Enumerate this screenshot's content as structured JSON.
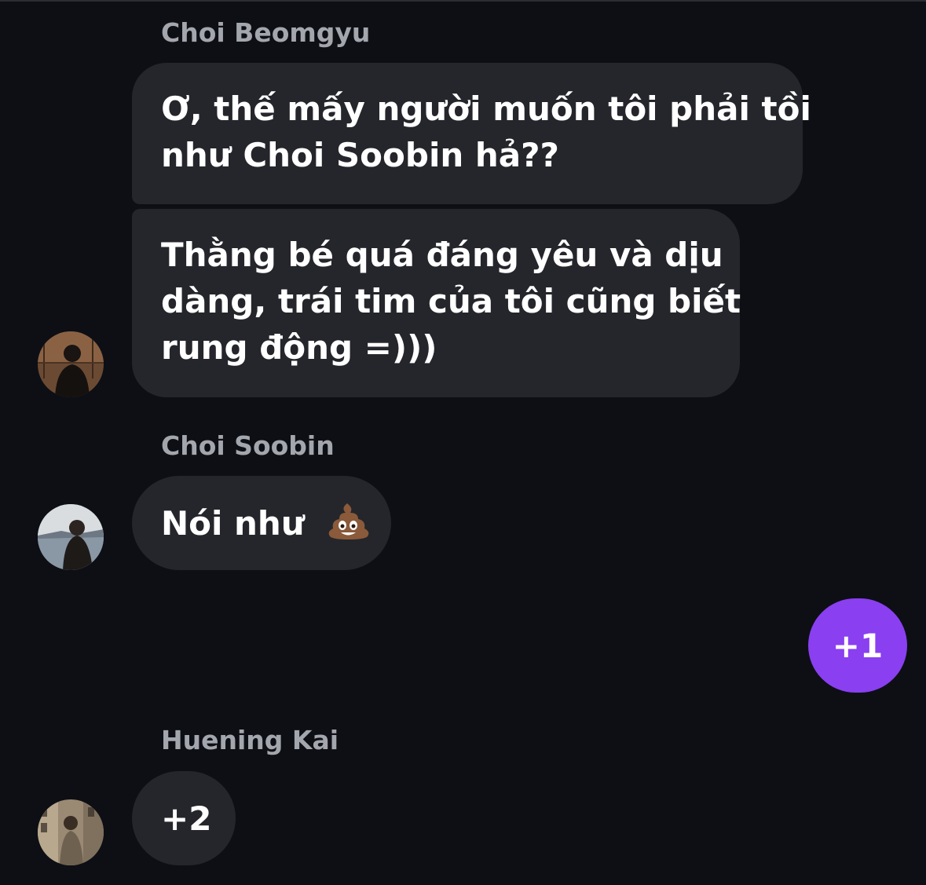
{
  "groups": [
    {
      "sender": "Choi Beomgyu",
      "messages": [
        {
          "lines": [
            "Ơ, thế mấy người muốn tôi phải tồi",
            "như Choi Soobin hả??"
          ]
        },
        {
          "lines": [
            "Thằng bé quá đáng yêu và dịu",
            "dàng, trái tim của tôi cũng biết",
            "rung động =)))"
          ]
        }
      ]
    },
    {
      "sender": "Choi Soobin",
      "messages": [
        {
          "text": "Nói như",
          "emoji": "pile-of-poo"
        }
      ]
    },
    {
      "sender": "Huening Kai",
      "messages": [
        {
          "text": "+2"
        }
      ]
    }
  ],
  "sent": {
    "text": "+1"
  },
  "colors": {
    "background": "#0d0f15",
    "received_bubble": "#24262b",
    "sent_bubble": "#8a3ff0",
    "sender_name": "#a3a6ad",
    "message_text": "#ffffff"
  }
}
